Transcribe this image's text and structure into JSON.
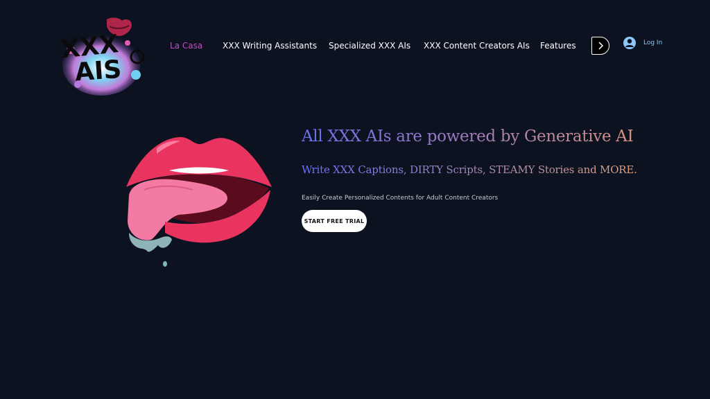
{
  "brand": {
    "logo_text_line1": "XXX",
    "logo_text_line2": "AIS"
  },
  "nav": {
    "items": [
      {
        "label": "La Casa",
        "active": true
      },
      {
        "label": "XXX Writing Assistants",
        "active": false
      },
      {
        "label": "Specialized XXX AIs",
        "active": false
      },
      {
        "label": "XXX Content Creators AIs",
        "active": false
      },
      {
        "label": "Features",
        "active": false
      }
    ],
    "more_icon": "chevron-right-icon",
    "login_label": "Log In",
    "login_icon": "user-avatar-icon"
  },
  "hero": {
    "title": "All XXX AIs are powered by Generative AI",
    "subtitle": "Write XXX Captions, DIRTY Scripts, STEAMY Stories and MORE.",
    "description": "Easily Create Personalized Contents for Adult Content Creators",
    "cta_label": "START FREE TRIAL"
  },
  "colors": {
    "background": "#0c1220",
    "active_nav": "#c04fc2",
    "login_text": "#8ec7f5",
    "lips": "#e8345e",
    "tongue": "#f27aa3"
  }
}
